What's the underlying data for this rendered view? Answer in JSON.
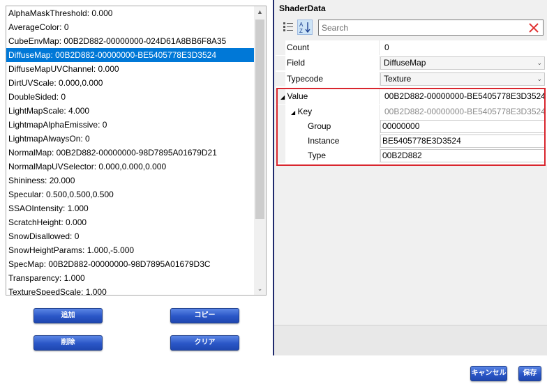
{
  "list": {
    "selected_index": 3,
    "items": [
      "AlphaMaskThreshold:  0.000",
      "AverageColor:  0",
      "CubeEnvMap:  00B2D882-00000000-024D61A8BB6F8A35",
      "DiffuseMap:  00B2D882-00000000-BE5405778E3D3524",
      "DiffuseMapUVChannel:  0.000",
      "DirtUVScale:  0.000,0.000",
      "DoubleSided:  0",
      "LightMapScale:  4.000",
      "LightmapAlphaEmissive:  0",
      "LightmapAlwaysOn:  0",
      "NormalMap:  00B2D882-00000000-98D7895A01679D21",
      "NormalMapUVSelector:  0.000,0.000,0.000",
      "Shininess:  20.000",
      "Specular:  0.500,0.500,0.500",
      "SSAOIntensity:  1.000",
      "ScratchHeight:  0.000",
      "SnowDisallowed:  0",
      "SnowHeightParams:  1.000,-5.000",
      "SpecMap:  00B2D882-00000000-98D7895A01679D3C",
      "Transparency:  1.000",
      "TextureSpeedScale:  1.000"
    ]
  },
  "buttons": {
    "add": "追加",
    "copy": "コピー",
    "delete": "削除",
    "clear": "クリア",
    "cancel": "キャンセル",
    "save": "保存"
  },
  "panel": {
    "title": "ShaderData",
    "search_placeholder": "Search",
    "rows": {
      "count": {
        "label": "Count",
        "value": "0"
      },
      "field": {
        "label": "Field",
        "value": "DiffuseMap"
      },
      "typecode": {
        "label": "Typecode",
        "value": "Texture"
      },
      "value": {
        "label": "Value",
        "value": "00B2D882-00000000-BE5405778E3D3524"
      },
      "key": {
        "label": "Key",
        "value": "00B2D882-00000000-BE5405778E3D3524"
      },
      "group": {
        "label": "Group",
        "value": "00000000"
      },
      "instance": {
        "label": "Instance",
        "value": "BE5405778E3D3524"
      },
      "type": {
        "label": "Type",
        "value": "00B2D882"
      }
    }
  },
  "colors": {
    "selection": "#0078d7",
    "highlight_border": "#d9262e",
    "button_blue": "#2a56c6",
    "divider": "#1f2a6d"
  },
  "icons": {
    "categorized": "categorized-view-icon",
    "alphabetical": "sort-alphabetical-icon",
    "clear_search": "close-icon",
    "expand": "triangle-down-icon",
    "dropdown": "chevron-down-icon"
  }
}
